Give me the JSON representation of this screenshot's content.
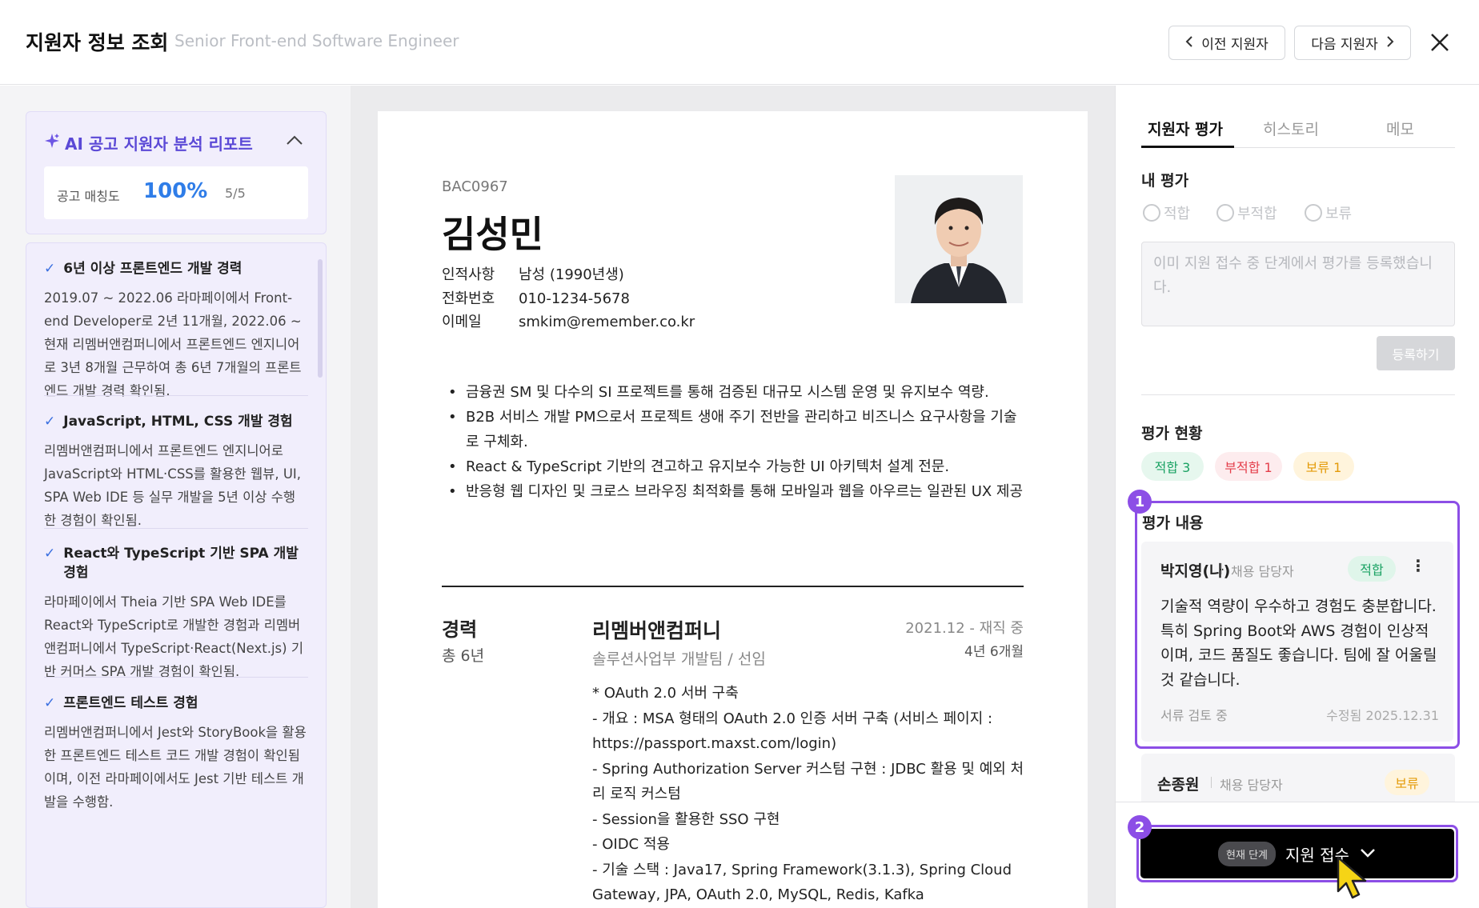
{
  "header": {
    "title": "지원자 정보 조회",
    "subtitle": "Senior Front-end Software Engineer",
    "prev_label": "이전 지원자",
    "next_label": "다음 지원자"
  },
  "ai_report": {
    "title": "AI 공고 지원자 분석 리포트",
    "match_label": "공고 매칭도",
    "match_percent": "100%",
    "match_fraction": "5/5",
    "items": [
      {
        "title": "6년 이상 프론트엔드 개발 경력",
        "body": "2019.07 ~ 2022.06 라마페이에서 Front-end Developer로 2년 11개월, 2022.06 ~ 현재 리멤버앤컴퍼니에서 프론트엔드 엔지니어로 3년 8개월 근무하여 총 6년 7개월의 프론트엔드 개발 경력 확인됨."
      },
      {
        "title": "JavaScript, HTML, CSS 개발 경험",
        "body": "리멤버앤컴퍼니에서 프론트엔드 엔지니어로 JavaScript와 HTML·CSS를 활용한 웹뷰, UI, SPA Web IDE 등 실무 개발을 5년 이상 수행한 경험이 확인됨."
      },
      {
        "title": "React와 TypeScript 기반 SPA 개발 경험",
        "body": "라마페이에서 Theia 기반 SPA Web IDE를 React와 TypeScript로 개발한 경험과 리멤버앤컴퍼니에서 TypeScript·React(Next.js) 기반 커머스 SPA 개발 경험이 확인됨."
      },
      {
        "title": "프론트엔드 테스트 경험",
        "body": "리멤버앤컴퍼니에서 Jest와 StoryBook을 활용한 프론트엔드 테스트 코드 개발 경험이 확인됨이며, 이전 라마페이에서도 Jest 기반 테스트 개발을 수행함."
      }
    ]
  },
  "resume": {
    "id": "BAC0967",
    "name": "김성민",
    "info": [
      {
        "key": "인적사항",
        "value": "남성 (1990년생)"
      },
      {
        "key": "전화번호",
        "value": "010-1234-5678"
      },
      {
        "key": "이메일",
        "value": "smkim@remember.co.kr"
      }
    ],
    "summary": [
      "금융권 SM 및 다수의 SI 프로젝트를 통해 검증된 대규모 시스템 운영 및 유지보수 역량.",
      "B2B 서비스 개발 PM으로서 프로젝트 생애 주기 전반을 관리하고 비즈니스 요구사항을 기술로 구체화.",
      "React & TypeScript 기반의 견고하고 유지보수 가능한 UI 아키텍처 설계 전문.",
      "반응형 웹 디자인 및 크로스 브라우징 최적화를 통해 모바일과 웹을 아우르는 일관된 UX 제공"
    ],
    "career": {
      "heading": "경력",
      "total": "총 6년",
      "company": "리멤버앤컴퍼니",
      "dept": "솔루션사업부 개발팀 / 선임",
      "period": "2021.12 - 재직 중",
      "duration": "4년 6개월",
      "lines": [
        "* OAuth 2.0 서버 구축",
        "- 개요 : MSA 형태의 OAuth 2.0 인증 서버 구축 (서비스 페이지 : https://passport.maxst.com/login)",
        "- Spring Authorization Server 커스텀 구현 : JDBC 활용 및 예외 처리 로직 커스텀",
        "- Session을 활용한 SSO 구현",
        "- OIDC 적용",
        "- 기술 스택 : Java17, Spring Framework(3.1.3), Spring Cloud Gateway, JPA, OAuth 2.0, MySQL, Redis, Kafka"
      ]
    }
  },
  "right": {
    "tabs": [
      "지원자 평가",
      "히스토리",
      "메모"
    ],
    "my_eval_heading": "내 평가",
    "radios": [
      "적합",
      "부적합",
      "보류"
    ],
    "textarea_placeholder": "이미 지원 접수 중 단계에서 평가를 등록했습니다.",
    "register_label": "등록하기",
    "status_heading": "평가 현황",
    "chips": {
      "good": "적합 3",
      "bad": "부적합 1",
      "hold": "보류 1"
    },
    "content_heading": "평가 내용",
    "badge1": "1",
    "badge2": "2",
    "evals": [
      {
        "name": "박지영(나)",
        "role": "채용 담당자",
        "status": "적합",
        "text": "기술적 역량이 우수하고 경험도 충분합니다. 특히 Spring Boot와 AWS 경험이 인상적이며, 코드 품질도 좋습니다. 팀에 잘 어울릴 것 같습니다.",
        "stage": "서류 검토 중",
        "modified": "수정됨  2025.12.31"
      },
      {
        "name": "손종원",
        "role": "채용 담당자",
        "status": "보류"
      }
    ],
    "stage_pill": "현재 단계",
    "stage_value": "지원 접수"
  },
  "colors": {
    "accent_purple": "#8c4ee6",
    "match_blue": "#2f7de8",
    "good": "#1aa263",
    "bad": "#e43d4a",
    "hold": "#e49b0a"
  }
}
